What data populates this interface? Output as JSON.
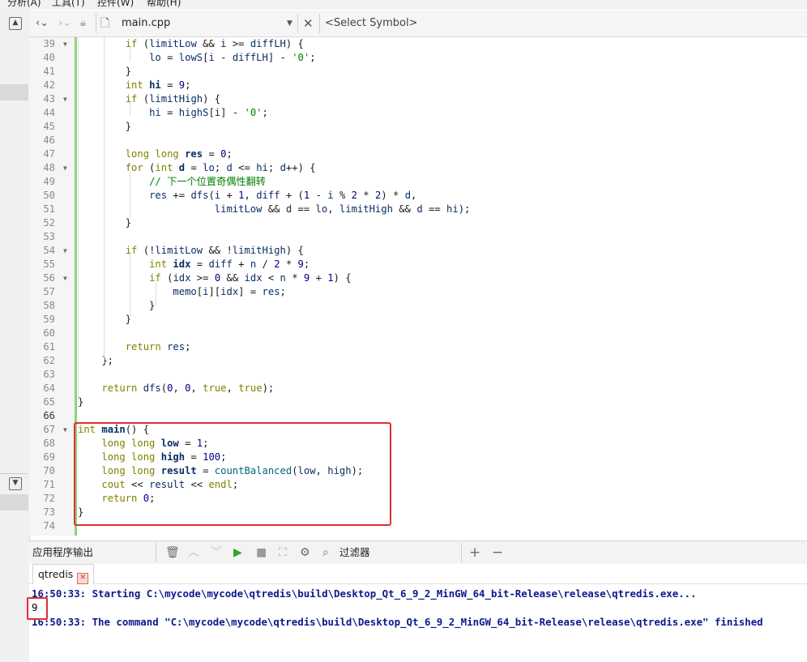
{
  "menu": [
    "分析(A)",
    "工具(T)",
    "控件(W)",
    "帮助(H)"
  ],
  "toolbar": {
    "file_name": "main.cpp",
    "symbol_placeholder": "<Select Symbol>"
  },
  "editor": {
    "lines": [
      {
        "n": "39",
        "fold": true,
        "html": "        <span class=\"kw\">if</span> (<span class=\"var\">limitLow</span> &amp;&amp; <span class=\"var\">i</span> &gt;= <span class=\"var\">diffLH</span>) {"
      },
      {
        "n": "40",
        "fold": false,
        "html": "            <span class=\"var\">lo</span> = <span class=\"var\">lowS</span>[<span class=\"var\">i</span> - <span class=\"var\">diffLH</span>] - <span class=\"str\">'0'</span>;"
      },
      {
        "n": "41",
        "fold": false,
        "html": "        }"
      },
      {
        "n": "42",
        "fold": false,
        "html": "        <span class=\"ty\">int</span> <span class=\"bold\">hi</span> = <span class=\"num\">9</span>;"
      },
      {
        "n": "43",
        "fold": true,
        "html": "        <span class=\"kw\">if</span> (<span class=\"var\">limitHigh</span>) {"
      },
      {
        "n": "44",
        "fold": false,
        "html": "            <span class=\"var\">hi</span> = <span class=\"var\">highS</span>[<span class=\"var\">i</span>] - <span class=\"str\">'0'</span>;"
      },
      {
        "n": "45",
        "fold": false,
        "html": "        }"
      },
      {
        "n": "46",
        "fold": false,
        "html": ""
      },
      {
        "n": "47",
        "fold": false,
        "html": "        <span class=\"ty\">long long</span> <span class=\"bold\">res</span> = <span class=\"num\">0</span>;"
      },
      {
        "n": "48",
        "fold": true,
        "html": "        <span class=\"kw\">for</span> (<span class=\"ty\">int</span> <span class=\"bold\">d</span> = <span class=\"var\">lo</span>; <span class=\"var\">d</span> &lt;= <span class=\"var\">hi</span>; <span class=\"var\">d</span>++) {"
      },
      {
        "n": "49",
        "fold": false,
        "html": "            <span class=\"cm\">// 下一个位置奇偶性翻转</span>"
      },
      {
        "n": "50",
        "fold": false,
        "html": "            <span class=\"var\">res</span> += <span class=\"var\">dfs</span>(<span class=\"var\">i</span> + <span class=\"num\">1</span>, <span class=\"var\">diff</span> + (<span class=\"num\">1</span> - <span class=\"var\">i</span> % <span class=\"num\">2</span> * <span class=\"num\">2</span>) * <span class=\"var\">d</span>,"
      },
      {
        "n": "51",
        "fold": false,
        "html": "                       <span class=\"var\">limitLow</span> &amp;&amp; <span class=\"var\">d</span> == <span class=\"var\">lo</span>, <span class=\"var\">limitHigh</span> &amp;&amp; <span class=\"var\">d</span> == <span class=\"var\">hi</span>);"
      },
      {
        "n": "52",
        "fold": false,
        "html": "        }"
      },
      {
        "n": "53",
        "fold": false,
        "html": ""
      },
      {
        "n": "54",
        "fold": true,
        "html": "        <span class=\"kw\">if</span> (!<span class=\"var\">limitLow</span> &amp;&amp; !<span class=\"var\">limitHigh</span>) {"
      },
      {
        "n": "55",
        "fold": false,
        "html": "            <span class=\"ty\">int</span> <span class=\"bold\">idx</span> = <span class=\"var\">diff</span> + <span class=\"var\">n</span> / <span class=\"num\">2</span> * <span class=\"num\">9</span>;"
      },
      {
        "n": "56",
        "fold": true,
        "html": "            <span class=\"kw\">if</span> (<span class=\"var\">idx</span> &gt;= <span class=\"num\">0</span> &amp;&amp; <span class=\"var\">idx</span> &lt; <span class=\"var\">n</span> * <span class=\"num\">9</span> + <span class=\"num\">1</span>) {"
      },
      {
        "n": "57",
        "fold": false,
        "html": "                <span class=\"var\">memo</span>[<span class=\"var\">i</span>][<span class=\"var\">idx</span>] = <span class=\"var\">res</span>;"
      },
      {
        "n": "58",
        "fold": false,
        "html": "            }"
      },
      {
        "n": "59",
        "fold": false,
        "html": "        }"
      },
      {
        "n": "60",
        "fold": false,
        "html": ""
      },
      {
        "n": "61",
        "fold": false,
        "html": "        <span class=\"kw\">return</span> <span class=\"var\">res</span>;"
      },
      {
        "n": "62",
        "fold": false,
        "html": "    };"
      },
      {
        "n": "63",
        "fold": false,
        "html": ""
      },
      {
        "n": "64",
        "fold": false,
        "html": "    <span class=\"kw\">return</span> <span class=\"var\">dfs</span>(<span class=\"num\">0</span>, <span class=\"num\">0</span>, <span class=\"kw\">true</span>, <span class=\"kw\">true</span>);"
      },
      {
        "n": "65",
        "fold": false,
        "html": "}"
      },
      {
        "n": "66",
        "fold": false,
        "html": "",
        "current": true
      },
      {
        "n": "67",
        "fold": true,
        "html": "<span class=\"ty\">int</span> <span class=\"bold\">main</span>() {"
      },
      {
        "n": "68",
        "fold": false,
        "html": "    <span class=\"ty\">long long</span> <span class=\"bold\">low</span> = <span class=\"num\">1</span>;"
      },
      {
        "n": "69",
        "fold": false,
        "html": "    <span class=\"ty\">long long</span> <span class=\"bold\">high</span> = <span class=\"num\">100</span>;"
      },
      {
        "n": "70",
        "fold": false,
        "html": "    <span class=\"ty\">long long</span> <span class=\"bold\">result</span> = <span class=\"fn\">countBalanced</span>(<span class=\"var\">low</span>, <span class=\"var\">high</span>);"
      },
      {
        "n": "71",
        "fold": false,
        "html": "    <span class=\"ty\">cout</span> &lt;&lt; <span class=\"var\">result</span> &lt;&lt; <span class=\"ty\">endl</span>;"
      },
      {
        "n": "72",
        "fold": false,
        "html": "    <span class=\"kw\">return</span> <span class=\"num\">0</span>;"
      },
      {
        "n": "73",
        "fold": false,
        "html": "}"
      },
      {
        "n": "74",
        "fold": false,
        "html": ""
      }
    ]
  },
  "output": {
    "panel_title": "应用程序输出",
    "filter_placeholder": "过滤器",
    "tab_label": "qtredis",
    "lines": [
      {
        "text": "16:50:33: Starting C:\\mycode\\mycode\\qtredis\\build\\Desktop_Qt_6_9_2_MinGW_64_bit-Release\\release\\qtredis.exe...",
        "plain": false
      },
      {
        "text": "9",
        "plain": true
      },
      {
        "text": "16:50:33: The command \"C:\\mycode\\mycode\\qtredis\\build\\Desktop_Qt_6_9_2_MinGW_64_bit-Release\\release\\qtredis.exe\" finished",
        "plain": false
      }
    ]
  }
}
